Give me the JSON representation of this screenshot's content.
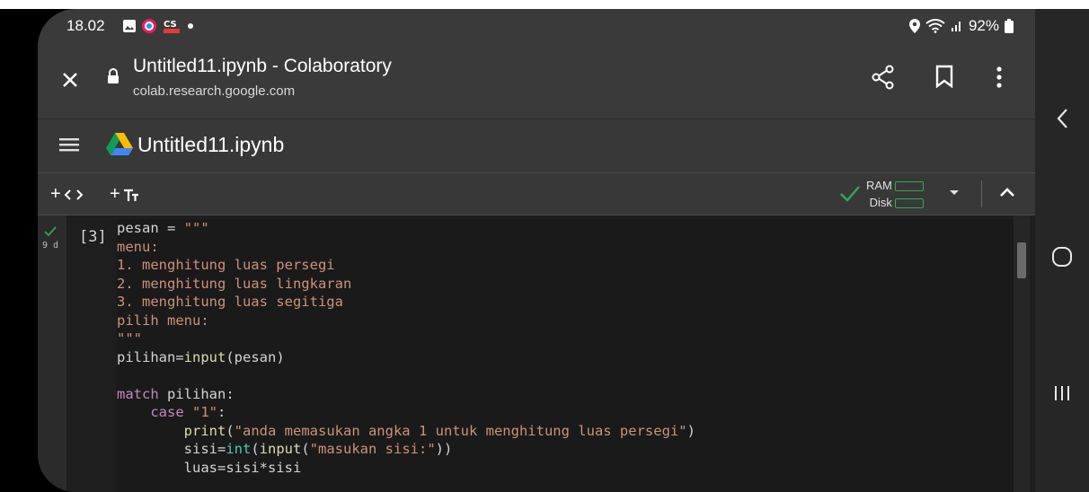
{
  "status_bar": {
    "time": "18.02",
    "battery": "92%",
    "icons": [
      "gallery-icon",
      "app-icon",
      "camscanner-icon",
      "dot-icon"
    ],
    "right_icons": [
      "location-icon",
      "wifi-icon",
      "signal-icon",
      "battery-icon"
    ]
  },
  "toolbar": {
    "title": "Untitled11.ipynb - Colaboratory",
    "url": "colab.research.google.com"
  },
  "colab": {
    "notebook_title": "Untitled11.ipynb",
    "add_code": "+",
    "add_text": "+",
    "ram_label": "RAM",
    "disk_label": "Disk"
  },
  "cell": {
    "exec_count": "[3]",
    "exec_time": "9 d",
    "lines": [
      [
        {
          "t": "pesan = ",
          "c": "plain"
        },
        {
          "t": "\"\"\"",
          "c": "str"
        }
      ],
      [
        {
          "t": "menu:",
          "c": "str"
        }
      ],
      [
        {
          "t": "1. menghitung luas persegi",
          "c": "str"
        }
      ],
      [
        {
          "t": "2. menghitung luas lingkaran",
          "c": "str"
        }
      ],
      [
        {
          "t": "3. menghitung luas segitiga",
          "c": "str"
        }
      ],
      [
        {
          "t": "pilih menu:",
          "c": "str"
        }
      ],
      [
        {
          "t": "\"\"\"",
          "c": "str"
        }
      ],
      [
        {
          "t": "pilihan=",
          "c": "plain"
        },
        {
          "t": "input",
          "c": "fn"
        },
        {
          "t": "(pesan)",
          "c": "plain"
        }
      ],
      [
        {
          "t": "",
          "c": "plain"
        }
      ],
      [
        {
          "t": "match",
          "c": "kw"
        },
        {
          "t": " pilihan:",
          "c": "plain"
        }
      ],
      [
        {
          "t": "    ",
          "c": "plain"
        },
        {
          "t": "case",
          "c": "kw"
        },
        {
          "t": " ",
          "c": "plain"
        },
        {
          "t": "\"1\"",
          "c": "str"
        },
        {
          "t": ":",
          "c": "plain"
        }
      ],
      [
        {
          "t": "        ",
          "c": "plain"
        },
        {
          "t": "print",
          "c": "fn"
        },
        {
          "t": "(",
          "c": "plain"
        },
        {
          "t": "\"anda memasukan angka 1 untuk menghitung luas persegi\"",
          "c": "str"
        },
        {
          "t": ")",
          "c": "plain"
        }
      ],
      [
        {
          "t": "        sisi=",
          "c": "plain"
        },
        {
          "t": "int",
          "c": "bi"
        },
        {
          "t": "(",
          "c": "plain"
        },
        {
          "t": "input",
          "c": "fn"
        },
        {
          "t": "(",
          "c": "plain"
        },
        {
          "t": "\"masukan sisi:\"",
          "c": "str"
        },
        {
          "t": "))",
          "c": "plain"
        }
      ],
      [
        {
          "t": "        luas=sisi*sisi",
          "c": "plain"
        }
      ]
    ]
  },
  "colors": {
    "status_bg": "#3a3a3a",
    "header_bg": "#383838",
    "editor_bg": "#1a1a1a",
    "accent_green": "#34a853",
    "string": "#ce9178",
    "keyword": "#c586c0",
    "function": "#dcdcaa",
    "builtin": "#4ec9b0"
  }
}
